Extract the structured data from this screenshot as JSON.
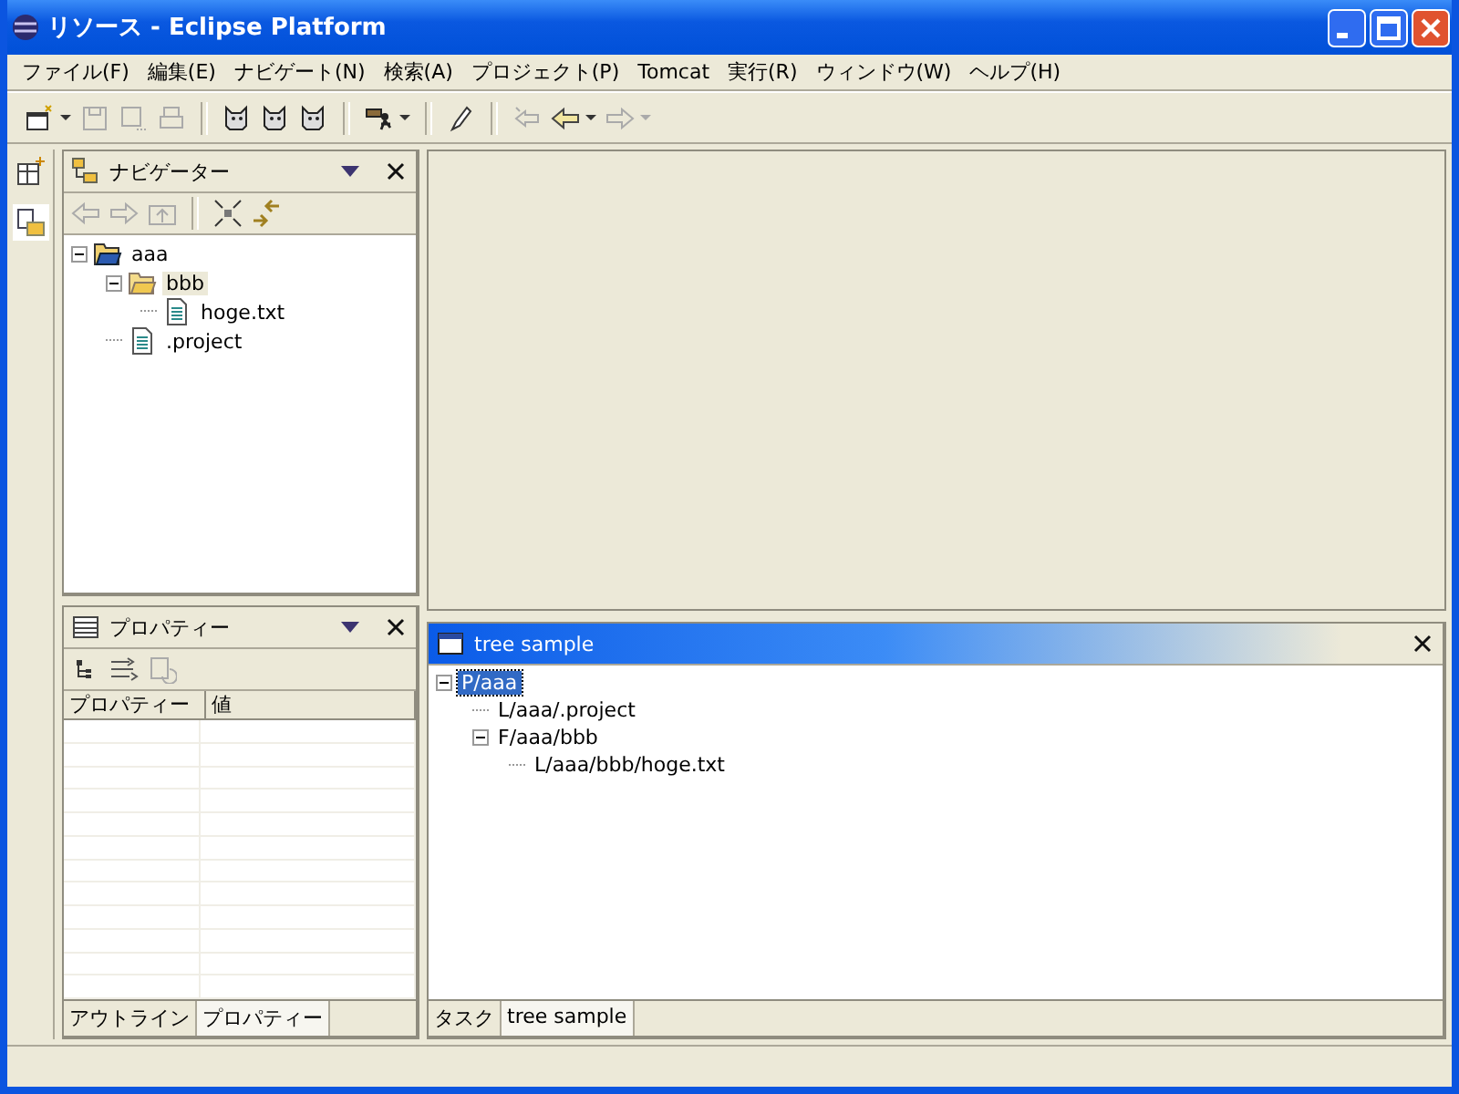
{
  "window": {
    "title": "リソース - Eclipse Platform"
  },
  "menu": [
    "ファイル(F)",
    "編集(E)",
    "ナビゲート(N)",
    "検索(A)",
    "プロジェクト(P)",
    "Tomcat",
    "実行(R)",
    "ウィンドウ(W)",
    "ヘルプ(H)"
  ],
  "navigator": {
    "title": "ナビゲーター",
    "tree": [
      {
        "label": "aaa",
        "kind": "project",
        "expanded": true,
        "selected": false,
        "children": [
          {
            "label": "bbb",
            "kind": "folder",
            "expanded": true,
            "selected": true,
            "children": [
              {
                "label": "hoge.txt",
                "kind": "file",
                "selected": false
              }
            ]
          },
          {
            "label": ".project",
            "kind": "file",
            "selected": false
          }
        ]
      }
    ]
  },
  "properties": {
    "title": "プロパティー",
    "columns": [
      "プロパティー",
      "値"
    ],
    "tabs": [
      {
        "label": "アウトライン",
        "selected": false
      },
      {
        "label": "プロパティー",
        "selected": true
      }
    ]
  },
  "tree_sample": {
    "title": "tree sample",
    "active": true,
    "tree": [
      {
        "label": "P/aaa",
        "expanded": true,
        "selected": true,
        "children": [
          {
            "label": "L/aaa/.project",
            "selected": false
          },
          {
            "label": "F/aaa/bbb",
            "expanded": true,
            "selected": false,
            "children": [
              {
                "label": "L/aaa/bbb/hoge.txt",
                "selected": false
              }
            ]
          }
        ]
      }
    ],
    "tabs": [
      {
        "label": "タスク",
        "selected": false
      },
      {
        "label": "tree sample",
        "selected": true
      }
    ]
  }
}
